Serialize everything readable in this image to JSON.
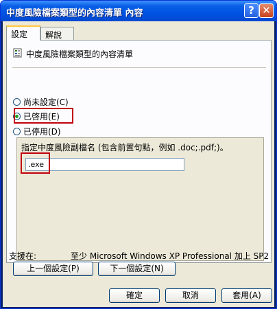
{
  "window": {
    "title": "中度風險檔案類型的內容清單 內容",
    "help_glyph": "?",
    "close_glyph": "✕"
  },
  "tabs": [
    {
      "label": "設定",
      "active": true
    },
    {
      "label": "解說",
      "active": false
    }
  ],
  "policy": {
    "title": "中度風險檔案類型的內容清單",
    "icon": "policy-document-icon"
  },
  "radios": [
    {
      "label": "尚未設定(C)",
      "checked": false
    },
    {
      "label": "已啓用(E)",
      "checked": true
    },
    {
      "label": "已停用(D)",
      "checked": false
    }
  ],
  "options": {
    "label": "指定中度風險副檔名 (包含前置句點，例如 .doc;.pdf;)。",
    "extension_value": ".exe"
  },
  "supported": {
    "label": "支援在:",
    "value": "至少 Microsoft Windows XP Professional 加上 SP2"
  },
  "nav_buttons": {
    "previous": "上一個設定(P)",
    "next": "下一個設定(N)"
  },
  "dialog_buttons": {
    "ok": "確定",
    "cancel": "取消",
    "apply": "套用(A)"
  },
  "colors": {
    "titlebar": "#0054e3",
    "highlight": "#c0000c",
    "radio_check": "#21a121"
  }
}
